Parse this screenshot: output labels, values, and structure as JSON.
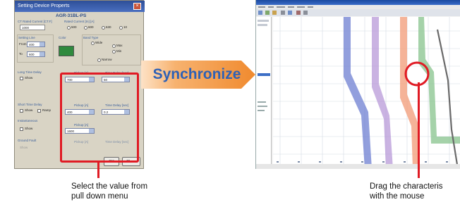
{
  "dialog": {
    "title": "Setting Device Properts",
    "model": "AGR-31BL-PS",
    "ct_label": "CT Rated Current [CT.F]",
    "ct_value": "1000",
    "rated_current_label": "Rated Current [In] [A]",
    "rated_current_options": [
      "500",
      "600",
      "630",
      "10"
    ],
    "setting_line_label": "Setting Line",
    "from_label": "From",
    "from_value": "400",
    "to_label": "To",
    "to_value": "600",
    "color_label": "Color",
    "color_value": "#2f8a3e",
    "band_type_label": "Band Type",
    "band_options": [
      "Wide",
      "Max",
      "Min",
      "Narrow"
    ],
    "long_time_label": "Long Time Delay",
    "show_label": "Show",
    "pickup_label": "Pickup [A]",
    "time_delay_label": "Time Delay [sec]",
    "pickup1_value": "700",
    "time1_value": "50",
    "short_time_label": "Short Time Delay",
    "ramp_label": "Ramp",
    "pickup2_value": "400",
    "time2_value": "0.2",
    "instantaneous_label": "Instantaneous",
    "pickup3_value": "1600",
    "ground_fault_label": "Ground Fault",
    "ok_label": "OK",
    "close_label": "Close"
  },
  "arrow_label": "Synchronize",
  "captions": {
    "left_line1": "Select the value from",
    "left_line2": "pull down menu",
    "right_line1": "Drag the characteris",
    "right_line2": "with the mouse"
  },
  "colors": {
    "highlight": "#e01b24",
    "arrow": "#f39a45",
    "curve_blue": "#6e7fd2",
    "curve_purple": "#b493d6",
    "curve_orange": "#f2a07e",
    "curve_green": "#8fc794",
    "curve_gray": "#6a6a6a"
  },
  "icons": {
    "close": "close-icon",
    "dropdown": "chevron-down-icon"
  }
}
